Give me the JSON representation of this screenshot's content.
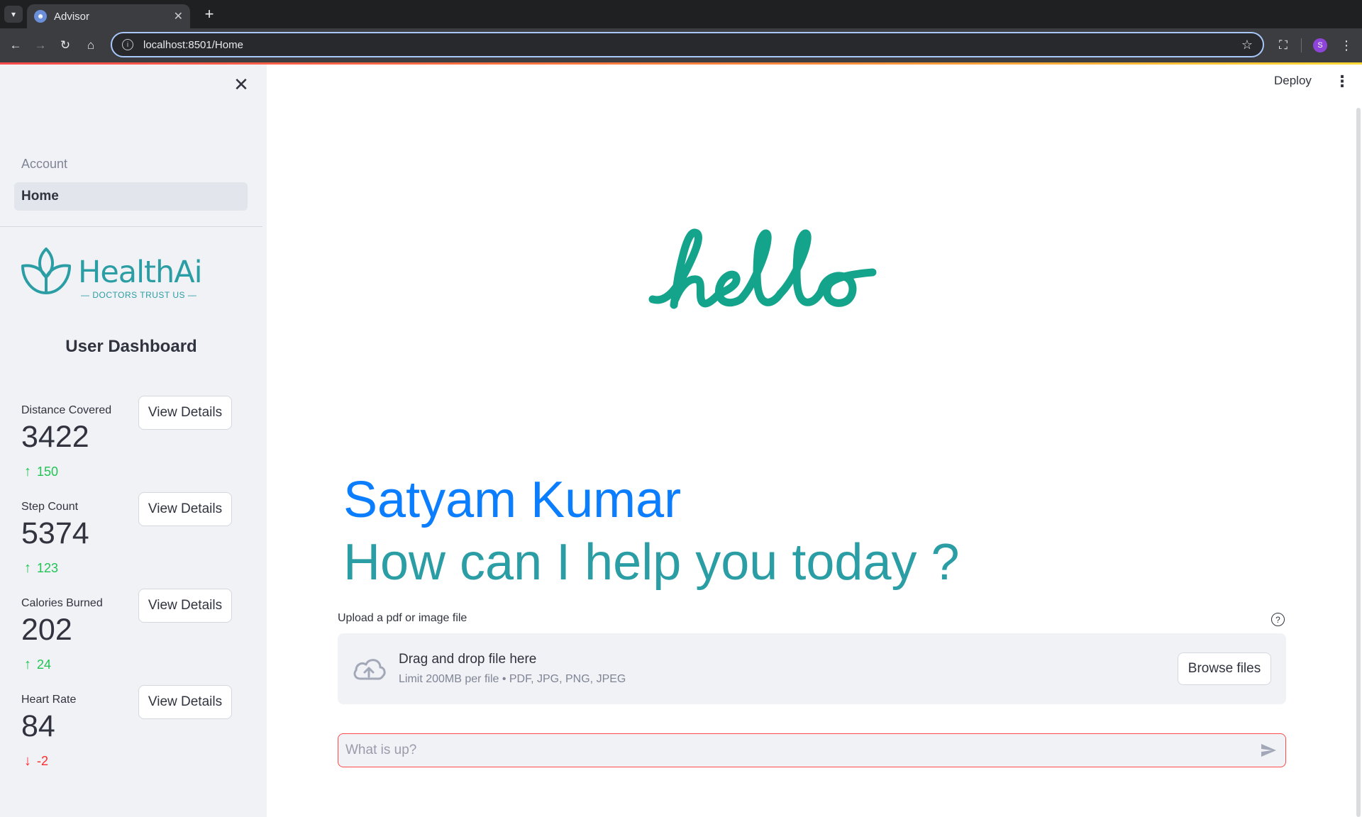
{
  "browser": {
    "tab_title": "Advisor",
    "url": "localhost:8501/Home",
    "profile_initial": "S"
  },
  "header": {
    "deploy_label": "Deploy"
  },
  "sidebar": {
    "section_label": "Account",
    "nav_items": [
      {
        "label": "Home",
        "active": true
      }
    ],
    "logo": {
      "name": "HealthAi",
      "tagline": "— DOCTORS TRUST US —"
    },
    "dashboard_title": "User Dashboard",
    "metrics": [
      {
        "label": "Distance Covered",
        "value": "3422",
        "delta": "150",
        "direction": "up",
        "button": "View Details"
      },
      {
        "label": "Step Count",
        "value": "5374",
        "delta": "123",
        "direction": "up",
        "button": "View Details"
      },
      {
        "label": "Calories Burned",
        "value": "202",
        "delta": "24",
        "direction": "up",
        "button": "View Details"
      },
      {
        "label": "Heart Rate",
        "value": "84",
        "delta": "-2",
        "direction": "down",
        "button": "View Details"
      }
    ]
  },
  "main": {
    "hello_text": "hello",
    "user_name": "Satyam Kumar",
    "prompt": "How can I help you today ?",
    "uploader": {
      "label": "Upload a pdf or image file",
      "drop_title": "Drag and drop file here",
      "drop_limits": "Limit 200MB per file • PDF, JPG, PNG, JPEG",
      "browse_label": "Browse files"
    },
    "chat": {
      "placeholder": "What is up?"
    }
  },
  "colors": {
    "accent": "#ff4b4b",
    "teal": "#2a9ea4",
    "name_blue": "#0b7dff",
    "delta_up": "#21c354",
    "delta_down": "#ff2b2b"
  }
}
